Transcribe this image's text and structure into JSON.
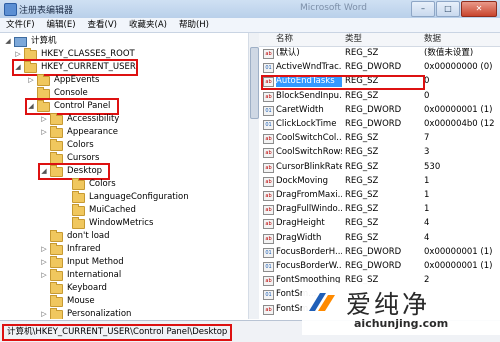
{
  "window": {
    "title": "注册表编辑器",
    "ghost_title": "Microsoft Word"
  },
  "window_buttons": [
    "–",
    "□",
    "✕"
  ],
  "menu": [
    "文件(F)",
    "编辑(E)",
    "查看(V)",
    "收藏夹(A)",
    "帮助(H)"
  ],
  "tree": [
    {
      "label": "计算机",
      "toggle": "◢",
      "icon": "computer"
    },
    {
      "label": "HKEY_CLASSES_ROOT",
      "toggle": "▷",
      "icon": "folder"
    },
    {
      "label": "HKEY_CURRENT_USER",
      "toggle": "◢",
      "icon": "folder",
      "highlight": true
    },
    {
      "label": "AppEvents",
      "toggle": "▷",
      "icon": "folder"
    },
    {
      "label": "Console",
      "toggle": "",
      "icon": "folder"
    },
    {
      "label": "Control Panel",
      "toggle": "◢",
      "icon": "folder",
      "highlight": true
    },
    {
      "label": "Accessibility",
      "toggle": "▷",
      "icon": "folder"
    },
    {
      "label": "Appearance",
      "toggle": "▷",
      "icon": "folder"
    },
    {
      "label": "Colors",
      "toggle": "",
      "icon": "folder"
    },
    {
      "label": "Cursors",
      "toggle": "",
      "icon": "folder"
    },
    {
      "label": "Desktop",
      "toggle": "◢",
      "icon": "folder",
      "highlight": true
    },
    {
      "label": "Colors",
      "toggle": "",
      "icon": "folder"
    },
    {
      "label": "LanguageConfiguration",
      "toggle": "",
      "icon": "folder"
    },
    {
      "label": "MuiCached",
      "toggle": "",
      "icon": "folder"
    },
    {
      "label": "WindowMetrics",
      "toggle": "",
      "icon": "folder"
    },
    {
      "label": "don't load",
      "toggle": "",
      "icon": "folder"
    },
    {
      "label": "Infrared",
      "toggle": "▷",
      "icon": "folder"
    },
    {
      "label": "Input Method",
      "toggle": "▷",
      "icon": "folder"
    },
    {
      "label": "International",
      "toggle": "▷",
      "icon": "folder"
    },
    {
      "label": "Keyboard",
      "toggle": "",
      "icon": "folder"
    },
    {
      "label": "Mouse",
      "toggle": "",
      "icon": "folder"
    },
    {
      "label": "Personalization",
      "toggle": "▷",
      "icon": "folder"
    }
  ],
  "values_header": {
    "name": "名称",
    "type": "类型",
    "data": "数据"
  },
  "values": [
    {
      "name": "(默认)",
      "type": "REG_SZ",
      "data": "(数值未设置)",
      "kind": "sz"
    },
    {
      "name": "ActiveWndTrac...",
      "type": "REG_DWORD",
      "data": "0x00000000 (0)",
      "kind": "dword"
    },
    {
      "name": "AutoEndTasks",
      "type": "REG_SZ",
      "data": "0",
      "kind": "sz",
      "selected": true
    },
    {
      "name": "BlockSendInpu...",
      "type": "REG_SZ",
      "data": "0",
      "kind": "sz"
    },
    {
      "name": "CaretWidth",
      "type": "REG_DWORD",
      "data": "0x00000001 (1)",
      "kind": "dword"
    },
    {
      "name": "ClickLockTime",
      "type": "REG_DWORD",
      "data": "0x000004b0 (12",
      "kind": "dword"
    },
    {
      "name": "CoolSwitchCol...",
      "type": "REG_SZ",
      "data": "7",
      "kind": "sz"
    },
    {
      "name": "CoolSwitchRows",
      "type": "REG_SZ",
      "data": "3",
      "kind": "sz"
    },
    {
      "name": "CursorBlinkRate",
      "type": "REG_SZ",
      "data": "530",
      "kind": "sz"
    },
    {
      "name": "DockMoving",
      "type": "REG_SZ",
      "data": "1",
      "kind": "sz"
    },
    {
      "name": "DragFromMaxi...",
      "type": "REG_SZ",
      "data": "1",
      "kind": "sz"
    },
    {
      "name": "DragFullWindo...",
      "type": "REG_SZ",
      "data": "1",
      "kind": "sz"
    },
    {
      "name": "DragHeight",
      "type": "REG_SZ",
      "data": "4",
      "kind": "sz"
    },
    {
      "name": "DragWidth",
      "type": "REG_SZ",
      "data": "4",
      "kind": "sz"
    },
    {
      "name": "FocusBorderH...",
      "type": "REG_DWORD",
      "data": "0x00000001 (1)",
      "kind": "dword"
    },
    {
      "name": "FocusBorderW...",
      "type": "REG_DWORD",
      "data": "0x00000001 (1)",
      "kind": "dword"
    },
    {
      "name": "FontSmoothing",
      "type": "REG_SZ",
      "data": "2",
      "kind": "sz"
    },
    {
      "name": "FontSm...",
      "type": "",
      "data": "",
      "kind": "dword"
    },
    {
      "name": "FontSm...",
      "type": "",
      "data": "",
      "kind": "sz"
    }
  ],
  "status": {
    "path": "计算机\\HKEY_CURRENT_USER\\Control Panel\\Desktop"
  },
  "watermark": {
    "cn": "爱纯净",
    "url": "aichunjing.com"
  },
  "colors": {
    "highlight_box": "#d11111",
    "selection": "#3399ff",
    "folder": "#f0c75e"
  }
}
